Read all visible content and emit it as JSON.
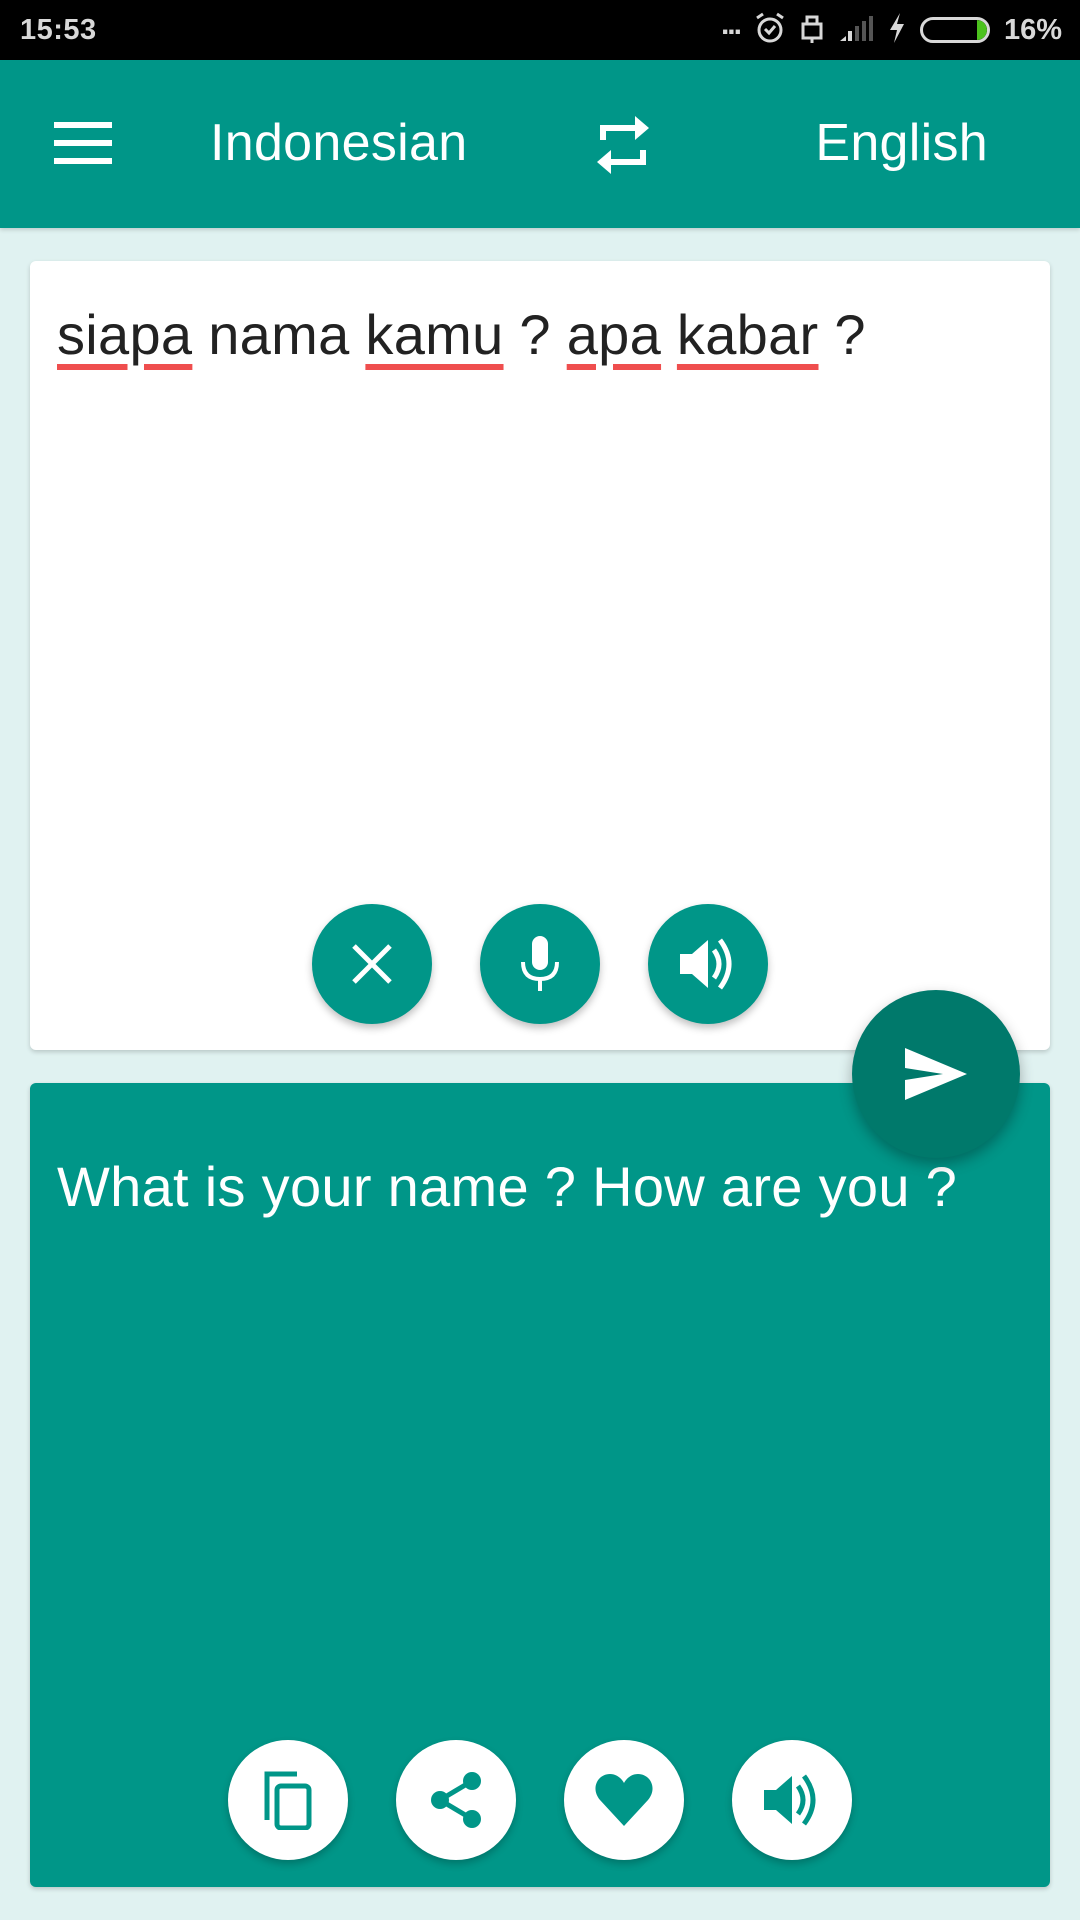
{
  "status_bar": {
    "time": "15:53",
    "more_indicator": "...",
    "icons": [
      "alarm-icon",
      "usb-lock-icon",
      "signal-icon",
      "charging-icon",
      "battery-icon"
    ],
    "battery_percent": "16%",
    "battery_level": 0.16,
    "battery_color": "#4CC21E"
  },
  "app_bar": {
    "menu_icon": "hamburger-menu-icon",
    "source_language": "Indonesian",
    "swap_icon": "swap-languages-icon",
    "target_language": "English",
    "background_color": "#009688"
  },
  "input": {
    "words": [
      {
        "text": "siapa",
        "misspelled": true
      },
      {
        "text": "nama",
        "misspelled": false
      },
      {
        "text": "kamu",
        "misspelled": true
      },
      {
        "text": "?",
        "misspelled": false
      },
      {
        "text": "apa",
        "misspelled": true
      },
      {
        "text": "kabar",
        "misspelled": true
      },
      {
        "text": "?",
        "misspelled": false
      }
    ],
    "text": "siapa nama kamu ? apa kabar ?",
    "buttons": [
      {
        "name": "clear",
        "icon": "close-icon"
      },
      {
        "name": "microphone",
        "icon": "microphone-icon"
      },
      {
        "name": "speak",
        "icon": "speaker-icon"
      }
    ]
  },
  "translate_button": {
    "icon": "send-icon",
    "color": "#00796B"
  },
  "output": {
    "text": "What is your name ? How are you ?",
    "buttons": [
      {
        "name": "copy",
        "icon": "copy-icon"
      },
      {
        "name": "share",
        "icon": "share-icon"
      },
      {
        "name": "favorite",
        "icon": "heart-icon"
      },
      {
        "name": "speak",
        "icon": "speaker-icon"
      }
    ]
  }
}
